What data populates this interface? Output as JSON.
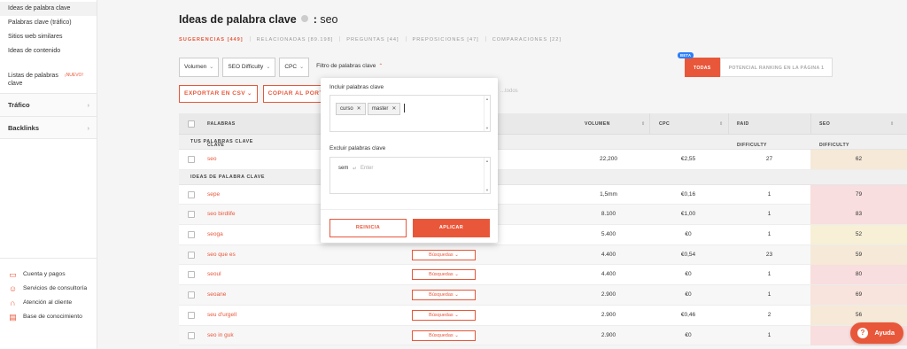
{
  "sidebar": {
    "items": [
      "Ideas de palabra clave",
      "Palabras clave (tráfico)",
      "Sitios web similares",
      "Ideas de contenido"
    ],
    "lists_label": "Listas de palabras clave",
    "lists_badge": "¡NUEVO!",
    "sections": [
      "Tráfico",
      "Backlinks"
    ],
    "bottom": [
      "Cuenta y pagos",
      "Servicios de consultoría",
      "Atención al cliente",
      "Base de conocimiento"
    ]
  },
  "header": {
    "title": "Ideas de palabra clave",
    "colon": ":",
    "keyword": "seo"
  },
  "tabs": [
    "SUGERENCIAS [449]",
    "RELACIONADAS [89.198]",
    "PREGUNTAS [44]",
    "PREPOSICIONES [47]",
    "COMPARACIONES [22]"
  ],
  "filters": {
    "volumen": "Volumen",
    "seo_difficulty": "SEO Difficulty",
    "cpc": "CPC",
    "keyword_filter": "Filtro de palabras clave"
  },
  "segment": {
    "beta": "BETA",
    "todas": "TODAS",
    "potencial": "POTENCIAL RANKING EN LA PÁGINA 1"
  },
  "actions": {
    "export": "EXPORTAR EN CSV",
    "copy": "COPIAR AL PORTAPAPELES",
    "ghost": "...todos"
  },
  "table": {
    "headers": {
      "keyword": "PALABRAS CLAVE",
      "volume": "VOLUMEN",
      "cpc": "CPC",
      "paid": "PAID DIFFICULTY",
      "seo": "SEO DIFFICULTY"
    },
    "group_yours": "TUS PALABRAS CLAVE",
    "group_ideas": "IDEAS DE PALABRA CLAVE",
    "busquedas": "Búsquedas",
    "rows": [
      {
        "kw": "seo",
        "vol": "22,200",
        "cpc": "€2,55",
        "paid": "27",
        "seo": "62",
        "color": "#f6e9d8",
        "busq": false
      },
      {
        "kw": "sepe",
        "vol": "1,5mm",
        "cpc": "€0,16",
        "paid": "1",
        "seo": "79",
        "color": "#f8dede",
        "busq": false
      },
      {
        "kw": "seo birdlife",
        "vol": "8.100",
        "cpc": "€1,00",
        "paid": "1",
        "seo": "83",
        "color": "#f8dede",
        "busq": false
      },
      {
        "kw": "seoga",
        "vol": "5.400",
        "cpc": "€0",
        "paid": "1",
        "seo": "52",
        "color": "#f7efd6",
        "busq": false
      },
      {
        "kw": "seo que es",
        "vol": "4.400",
        "cpc": "€0,54",
        "paid": "23",
        "seo": "59",
        "color": "#f6e9d8",
        "busq": true
      },
      {
        "kw": "seoul",
        "vol": "4.400",
        "cpc": "€0",
        "paid": "1",
        "seo": "80",
        "color": "#f8dede",
        "busq": true
      },
      {
        "kw": "seoane",
        "vol": "2.900",
        "cpc": "€0",
        "paid": "1",
        "seo": "69",
        "color": "#f8e4dc",
        "busq": true
      },
      {
        "kw": "seu d'urgell",
        "vol": "2.900",
        "cpc": "€0,46",
        "paid": "2",
        "seo": "56",
        "color": "#f6e9d8",
        "busq": true
      },
      {
        "kw": "seo in guk",
        "vol": "2.900",
        "cpc": "€0",
        "paid": "1",
        "seo": "87",
        "color": "#f8dede",
        "busq": true
      }
    ]
  },
  "popup": {
    "include_label": "Incluir palabras clave",
    "include_tags": [
      "curso",
      "master"
    ],
    "exclude_label": "Excluir palabras clave",
    "exclude_value": "sem",
    "exclude_hint": "Enter",
    "reset": "REINICIA",
    "apply": "APLICAR"
  },
  "help": {
    "label": "Ayuda"
  }
}
